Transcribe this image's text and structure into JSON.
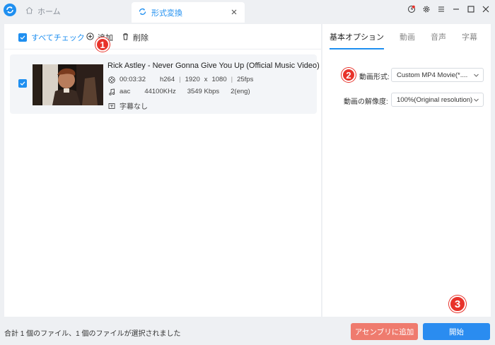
{
  "titlebar": {
    "home_tab_label": "ホーム",
    "convert_tab_label": "形式変換",
    "icons": [
      "app-logo-icon",
      "home-icon",
      "refresh-icon",
      "close-icon",
      "record-icon",
      "gear-icon",
      "menu-icon",
      "minimize-icon",
      "maximize-icon",
      "window-close-icon"
    ]
  },
  "toolbar": {
    "check_all_label": "すべてチェック",
    "add_label": "追加",
    "delete_label": "削除"
  },
  "file": {
    "title": "Rick Astley - Never Gonna Give You Up (Official Music Video)",
    "duration": "00:03:32",
    "video_codec": "h264",
    "width": "1920",
    "x": "x",
    "height": "1080",
    "fps": "25fps",
    "audio_codec": "aac",
    "sample_rate": "44100KHz",
    "bitrate": "3549 Kbps",
    "channels": "2(eng)",
    "subtitle": "字幕なし",
    "separator": "|"
  },
  "options": {
    "tabs": [
      "基本オプション",
      "動画",
      "音声",
      "字幕"
    ],
    "active_tab": 0,
    "format_label": "動画形式:",
    "format_value": "Custom MP4 Movie(*....",
    "resolution_label": "動画の解像度:",
    "resolution_value": "100%(Original resolution)"
  },
  "badges": [
    "1",
    "2",
    "3"
  ],
  "status": {
    "text": "合計 1 個のファイル、1 個のファイルが選択されました"
  },
  "buttons": {
    "assembly_label": "アセンブリに追加",
    "start_label": "開始"
  },
  "colors": {
    "accent": "#1f8ff0",
    "badge": "#e8322a",
    "assembly_button": "#ef7b6e",
    "start_button": "#2a8cf0"
  }
}
